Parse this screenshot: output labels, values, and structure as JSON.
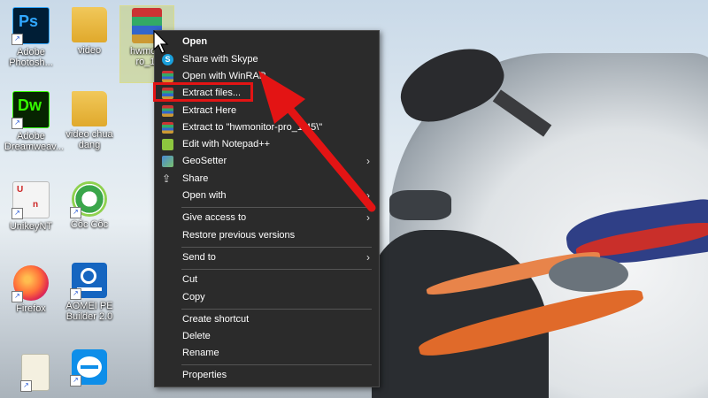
{
  "desktop_icons": [
    {
      "label": "Adobe Photosh...",
      "icon": "photoshop-icon",
      "badge": "Ps"
    },
    {
      "label": "video",
      "icon": "folder-icon"
    },
    {
      "label": "hwmonitor-pro_1.45",
      "icon": "winrar-archive-icon"
    },
    {
      "label": "Adobe Dreamweav...",
      "icon": "dreamweaver-icon",
      "badge": "Dw"
    },
    {
      "label": "video chua dang",
      "icon": "folder-icon"
    },
    {
      "label": "UnikeyNT",
      "icon": "unikey-icon"
    },
    {
      "label": "Cốc Cốc",
      "icon": "coccoc-icon"
    },
    {
      "label": "Firefox",
      "icon": "firefox-icon"
    },
    {
      "label": "AOMEI PE Builder 2.0",
      "icon": "aomei-icon"
    },
    {
      "label": "",
      "icon": "document-icon"
    },
    {
      "label": "",
      "icon": "teamviewer-icon"
    }
  ],
  "hwmonitor_label_visible": "hwmoni ro_1.",
  "context_menu": {
    "items": [
      {
        "label": "Open",
        "bold": true,
        "icon": ""
      },
      {
        "label": "Share with Skype",
        "icon": "skype-icon"
      },
      {
        "label": "Open with WinRAR",
        "icon": "winrar-icon"
      },
      {
        "label": "Extract files...",
        "icon": "winrar-icon",
        "highlighted": true
      },
      {
        "label": "Extract Here",
        "icon": "winrar-icon"
      },
      {
        "label": "Extract to \"hwmonitor-pro_1.45\\\"",
        "icon": "winrar-icon"
      },
      {
        "label": "Edit with Notepad++",
        "icon": "notepadpp-icon"
      },
      {
        "label": "GeoSetter",
        "icon": "geosetter-icon",
        "submenu": true
      },
      {
        "label": "Share",
        "icon": "share-icon"
      },
      {
        "label": "Open with",
        "icon": "",
        "submenu": true
      },
      {
        "label": "Give access to",
        "icon": "",
        "submenu": true
      },
      {
        "label": "Restore previous versions",
        "icon": ""
      },
      {
        "label": "Send to",
        "icon": "",
        "submenu": true
      },
      {
        "label": "Cut",
        "icon": ""
      },
      {
        "label": "Copy",
        "icon": ""
      },
      {
        "label": "Create shortcut",
        "icon": ""
      },
      {
        "label": "Delete",
        "icon": ""
      },
      {
        "label": "Rename",
        "icon": ""
      },
      {
        "label": "Properties",
        "icon": ""
      }
    ]
  },
  "colors": {
    "menu_bg": "#2b2b2b",
    "highlight_red": "#e31414"
  }
}
